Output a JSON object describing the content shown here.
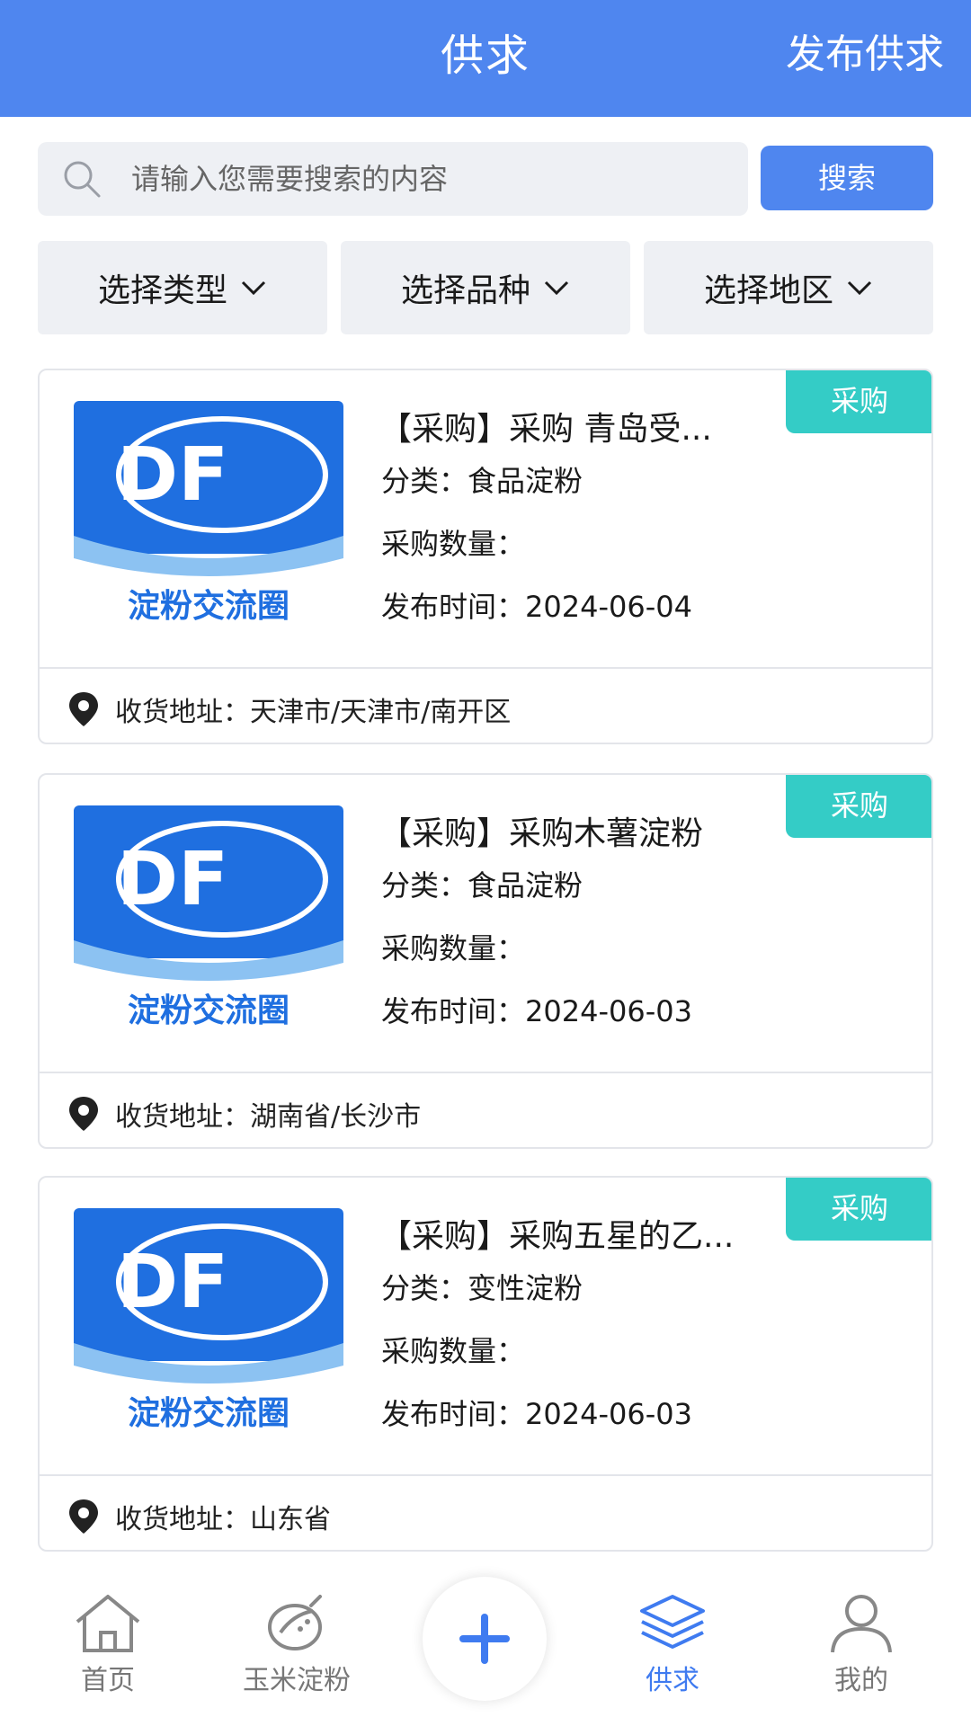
{
  "header": {
    "title": "供求",
    "action_label": "发布供求"
  },
  "search": {
    "placeholder": "请输入您需要搜索的内容",
    "button_label": "搜索"
  },
  "filters": [
    {
      "label": "选择类型"
    },
    {
      "label": "选择品种"
    },
    {
      "label": "选择地区"
    }
  ],
  "logo": {
    "letters": "DF",
    "caption": "淀粉交流圈"
  },
  "cards": [
    {
      "badge": "采购",
      "title": "【采购】采购 青岛受...",
      "category": "分类：食品淀粉",
      "quantity": "采购数量：",
      "date": "发布时间：2024-06-04",
      "address": "收货地址：天津市/天津市/南开区"
    },
    {
      "badge": "采购",
      "title": "【采购】采购木薯淀粉",
      "category": "分类：食品淀粉",
      "quantity": "采购数量：",
      "date": "发布时间：2024-06-03",
      "address": "收货地址：湖南省/长沙市"
    },
    {
      "badge": "采购",
      "title": "【采购】采购五星的乙...",
      "category": "分类：变性淀粉",
      "quantity": "采购数量：",
      "date": "发布时间：2024-06-03",
      "address": "收货地址：山东省"
    }
  ],
  "nav": {
    "items": [
      {
        "label": "首页",
        "icon": "home-icon"
      },
      {
        "label": "玉米淀粉",
        "icon": "corn-icon"
      },
      {
        "label": "供求",
        "icon": "layers-icon",
        "active": true
      },
      {
        "label": "我的",
        "icon": "user-icon"
      }
    ],
    "fab_icon": "plus-icon"
  },
  "colors": {
    "brand": "#4f86ef",
    "badge": "#34ccc6",
    "nav_active": "#3f7bf0"
  }
}
